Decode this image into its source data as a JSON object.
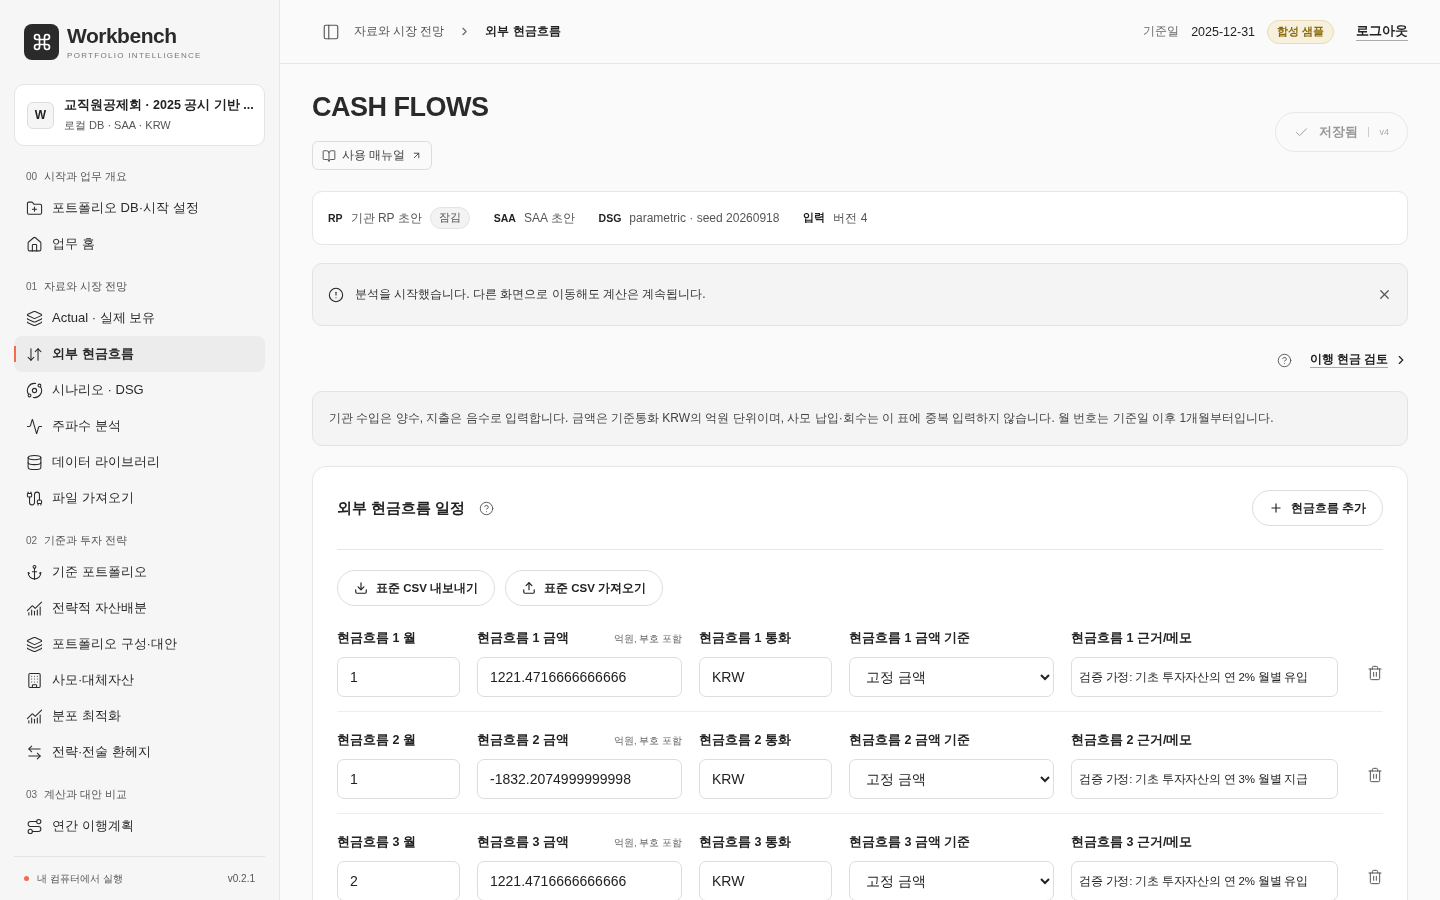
{
  "brand": {
    "name": "Workbench",
    "tagline": "PORTFOLIO INTELLIGENCE"
  },
  "project": {
    "avatar": "W",
    "title": "교직원공제회 · 2025 공시 기반 ...",
    "subtitle": "로컬 DB · SAA · KRW"
  },
  "sidebar": {
    "groups": [
      {
        "number": "00",
        "title": "시작과 업무 개요",
        "items": [
          {
            "label": "포트폴리오 DB·시작 설정",
            "selected": false
          },
          {
            "label": "업무 홈",
            "selected": false
          }
        ]
      },
      {
        "number": "01",
        "title": "자료와 시장 전망",
        "items": [
          {
            "label": "Actual · 실제 보유",
            "selected": false
          },
          {
            "label": "외부 현금흐름",
            "selected": true
          },
          {
            "label": "시나리오 · DSG",
            "selected": false
          },
          {
            "label": "주파수 분석",
            "selected": false
          },
          {
            "label": "데이터 라이브러리",
            "selected": false
          },
          {
            "label": "파일 가져오기",
            "selected": false
          }
        ]
      },
      {
        "number": "02",
        "title": "기준과 투자 전략",
        "items": [
          {
            "label": "기준 포트폴리오",
            "selected": false
          },
          {
            "label": "전략적 자산배분",
            "selected": false
          },
          {
            "label": "포트폴리오 구성·대안",
            "selected": false
          },
          {
            "label": "사모·대체자산",
            "selected": false
          },
          {
            "label": "분포 최적화",
            "selected": false
          },
          {
            "label": "전략·전술 환헤지",
            "selected": false
          }
        ]
      },
      {
        "number": "03",
        "title": "계산과 대안 비교",
        "items": [
          {
            "label": "연간 이행계획",
            "selected": false
          }
        ]
      }
    ]
  },
  "status": {
    "label": "내 컴퓨터에서 실행",
    "color": "#f26b4f",
    "version": "v0.2.1"
  },
  "breadcrumb": [
    "자료와 시장 전망",
    "외부 현금흐름"
  ],
  "header": {
    "date_label": "기준일",
    "date": "2025-12-31",
    "badge": "합성 샘플",
    "logout": "로그아웃"
  },
  "page": {
    "title": "CASH FLOWS",
    "manual_button": "사용 매뉴얼",
    "save_state": {
      "label": "저장됨",
      "version": "v4"
    }
  },
  "context": [
    {
      "key": "RP",
      "value": "기관 RP 초안",
      "tag": "잠김"
    },
    {
      "key": "SAA",
      "value": "SAA 초안"
    },
    {
      "key": "DSG",
      "value": "parametric · seed 20260918"
    },
    {
      "key": "입력",
      "value": "버전 4"
    }
  ],
  "alert": {
    "message": "분석을 시작했습니다. 다른 화면으로 이동해도 계산은 계속됩니다."
  },
  "review_link": "이행 현금 검토",
  "note": "기관 수입은 양수, 지출은 음수로 입력합니다. 금액은 기준통화 KRW의 억원 단위이며, 사모 납입·회수는 이 표에 중복 입력하지 않습니다. 월 번호는 기준일 이후 1개월부터입니다.",
  "schedule": {
    "title": "외부 현금흐름 일정",
    "add_button": "현금흐름 추가",
    "export_button": "표준 CSV 내보내기",
    "import_button": "표준 CSV 가져오기",
    "rows": [
      {
        "month_label": "현금흐름 1 월",
        "month": "1",
        "amount_label": "현금흐름 1 금액",
        "amount_hint": "억원, 부호 포함",
        "amount": "1221.4716666666666",
        "currency_label": "현금흐름 1 통화",
        "currency": "KRW",
        "basis_label": "현금흐름 1 금액 기준",
        "basis": "고정 금액",
        "memo_label": "현금흐름 1 근거/메모",
        "memo": "검증 가정: 기초 투자자산의 연 2% 월별 유입"
      },
      {
        "month_label": "현금흐름 2 월",
        "month": "1",
        "amount_label": "현금흐름 2 금액",
        "amount_hint": "억원, 부호 포함",
        "amount": "-1832.2074999999998",
        "currency_label": "현금흐름 2 통화",
        "currency": "KRW",
        "basis_label": "현금흐름 2 금액 기준",
        "basis": "고정 금액",
        "memo_label": "현금흐름 2 근거/메모",
        "memo": "검증 가정: 기초 투자자산의 연 3% 월별 지급"
      },
      {
        "month_label": "현금흐름 3 월",
        "month": "2",
        "amount_label": "현금흐름 3 금액",
        "amount_hint": "억원, 부호 포함",
        "amount": "1221.4716666666666",
        "currency_label": "현금흐름 3 통화",
        "currency": "KRW",
        "basis_label": "현금흐름 3 금액 기준",
        "basis": "고정 금액",
        "memo_label": "현금흐름 3 근거/메모",
        "memo": "검증 가정: 기초 투자자산의 연 2% 월별 유입"
      }
    ]
  }
}
